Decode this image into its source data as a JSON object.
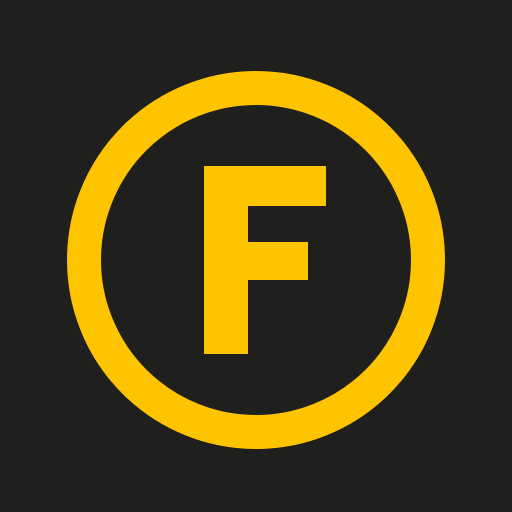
{
  "logo": {
    "letter": "F",
    "icon": "circled-letter-f-icon"
  },
  "colors": {
    "background": "#1f1f1e",
    "accent": "#ffc400"
  }
}
